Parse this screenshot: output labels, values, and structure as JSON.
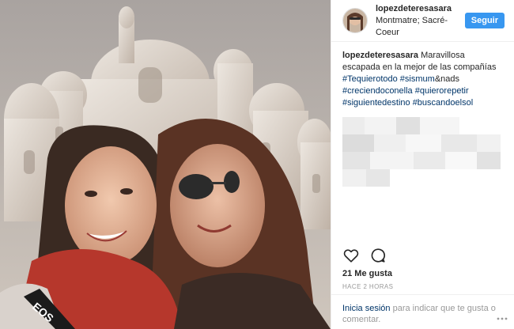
{
  "post": {
    "username": "lopezdeteresasara",
    "location": "Montmatre; Sacré-Coeur",
    "follow_label": "Seguir",
    "caption": {
      "user": "lopezdeteresasara",
      "text": "Maravillosa escapada en la mejor de las compañías",
      "tag1": "#Tequierotodo",
      "tag2": "#sismum",
      "mid": "&nads",
      "tag3": "#creciendoconella",
      "tag4": "#quierorepetir",
      "tag5": "#siguientedestino",
      "tag6": "#buscandoelsol"
    },
    "likes": "21 Me gusta",
    "time": "HACE 2 HORAS",
    "login_prompt": {
      "link": "Inicia sesión",
      "text": "para indicar que te gusta o comentar."
    },
    "photo_text": "EOS"
  },
  "icons": [
    "heart-icon",
    "comment-icon",
    "more-options-icon"
  ],
  "colors": {
    "accent": "#3897f0",
    "hashtag": "#003569",
    "muted": "#999999"
  }
}
